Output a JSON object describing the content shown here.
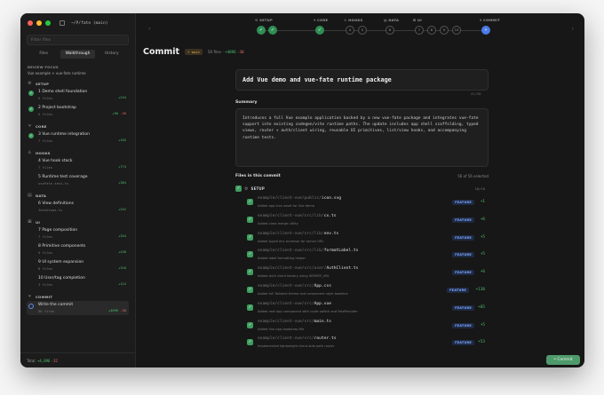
{
  "sidebar": {
    "repo": "~/P/fate (main)",
    "filter_placeholder": "Filter files",
    "tabs": [
      {
        "label": "Files",
        "active": false
      },
      {
        "label": "Walkthrough",
        "active": true
      },
      {
        "label": "History",
        "active": false
      }
    ],
    "review_focus": {
      "heading": "REVIEW FOCUS",
      "subtitle": "Vue example + vue-fate runtime"
    },
    "sections": [
      {
        "name": "SETUP",
        "items": [
          {
            "num": "1",
            "title": "Demo shell foundation",
            "sub": "5 files",
            "add": "+244",
            "del": "",
            "done": true
          },
          {
            "num": "2",
            "title": "Project bootstrap",
            "sub": "5 files",
            "add": "+90",
            "del": "-30",
            "done": true
          }
        ]
      },
      {
        "name": "CORE",
        "items": [
          {
            "num": "3",
            "title": "Vue runtime integration",
            "sub": "7 files",
            "add": "+183",
            "del": "",
            "done": true
          }
        ]
      },
      {
        "name": "HOOKS",
        "items": [
          {
            "num": "4",
            "title": "Vue hook stack",
            "sub": "7 files",
            "add": "+774",
            "del": "",
            "done": false
          },
          {
            "num": "5",
            "title": "Runtime test coverage",
            "sub": "useFate.test.ts",
            "add": "+384",
            "del": "",
            "done": false
          }
        ]
      },
      {
        "name": "DATA",
        "items": [
          {
            "num": "6",
            "title": "View definitions",
            "sub": "fateViews.ts",
            "add": "+242",
            "del": "",
            "done": false
          }
        ]
      },
      {
        "name": "UI",
        "items": [
          {
            "num": "7",
            "title": "Page composition",
            "sub": "7 files",
            "add": "+344",
            "del": "",
            "done": false
          },
          {
            "num": "8",
            "title": "Primitive components",
            "sub": "5 files",
            "add": "+430",
            "del": "",
            "done": false
          },
          {
            "num": "9",
            "title": "UI system expansion",
            "sub": "8 files",
            "add": "+310",
            "del": "",
            "done": false
          },
          {
            "num": "10",
            "title": "User/tag completion",
            "sub": "3 files",
            "add": "+124",
            "del": "",
            "done": false
          }
        ]
      },
      {
        "name": "COMMIT",
        "items": [
          {
            "num": "",
            "title": "Write the commit",
            "sub": "56 files",
            "add": "+4096",
            "del": "-30",
            "done": false,
            "selected": true
          }
        ]
      }
    ],
    "footer": {
      "label": "Total",
      "add": "+4,096",
      "del": "-32"
    }
  },
  "stepper": {
    "groups": [
      {
        "label": "SETUP",
        "icon": "⚙",
        "steps": [
          {
            "text": "✓",
            "state": "done"
          },
          {
            "text": "✓",
            "state": "done"
          }
        ]
      },
      {
        "label": "CORE",
        "icon": "⑂",
        "steps": [
          {
            "text": "✓",
            "state": "done"
          }
        ]
      },
      {
        "label": "HOOKS",
        "icon": "♙",
        "steps": [
          {
            "text": "4",
            "state": "todo"
          },
          {
            "text": "5",
            "state": "todo"
          }
        ]
      },
      {
        "label": "DATA",
        "icon": "▤",
        "steps": [
          {
            "text": "6",
            "state": "todo"
          }
        ]
      },
      {
        "label": "UI",
        "icon": "⊞",
        "steps": [
          {
            "text": "7",
            "state": "todo"
          },
          {
            "text": "8",
            "state": "todo"
          },
          {
            "text": "9",
            "state": "todo"
          },
          {
            "text": "10",
            "state": "todo"
          }
        ]
      },
      {
        "label": "COMMIT",
        "icon": "⑂",
        "steps": [
          {
            "text": "⑂",
            "state": "cur"
          }
        ]
      }
    ]
  },
  "page": {
    "title": "Commit",
    "branch": "main",
    "files_changed": "56 files",
    "add": "+4096",
    "del": "-30"
  },
  "commit": {
    "title": "Add Vue demo and vue-fate runtime package",
    "char_count": "41/50",
    "summary_label": "Summary",
    "summary": "Introduces a full Vue example application backed by a new vue-fate package and integrates vue-fate support into existing codegen/vite runtime paths. The update includes app shell scaffolding, typed views, router + auth/client wiring, reusable UI primitives, list/view hooks, and accompanying runtime tests.",
    "files_label": "Files in this commit",
    "files_selected": "56 of 56 selected",
    "group": {
      "name": "SETUP",
      "count": "10/10"
    },
    "files": [
      {
        "dir": "example/client-vue/public/",
        "name": "icon.svg",
        "desc": "Added app icon asset for Vue demo",
        "tag": "FEATURE",
        "add": "+1"
      },
      {
        "dir": "example/client-vue/src/lib/",
        "name": "cx.ts",
        "desc": "Added class merge utility",
        "tag": "FEATURE",
        "add": "+6"
      },
      {
        "dir": "example/client-vue/src/lib/",
        "name": "env.ts",
        "desc": "Added typed env accessor for server URL",
        "tag": "FEATURE",
        "add": "+5"
      },
      {
        "dir": "example/client-vue/src/lib/",
        "name": "formatLabel.ts",
        "desc": "Added label formatting helper",
        "tag": "FEATURE",
        "add": "+5"
      },
      {
        "dir": "example/client-vue/src/user/",
        "name": "AuthClient.ts",
        "desc": "Added Auth client factory using SERVER_URL",
        "tag": "FEATURE",
        "add": "+6"
      },
      {
        "dir": "example/client-vue/src/",
        "name": "App.css",
        "desc": "Added full Tailwind theme and component style baseline",
        "tag": "FEATURE",
        "add": "+130"
      },
      {
        "dir": "example/client-vue/src/",
        "name": "App.vue",
        "desc": "Added root app component with route switch and FateProvider",
        "tag": "FEATURE",
        "add": "+85"
      },
      {
        "dir": "example/client-vue/src/",
        "name": "main.ts",
        "desc": "Added Vue app bootstrap file",
        "tag": "FEATURE",
        "add": "+5"
      },
      {
        "dir": "example/client-vue/src/",
        "name": "router.ts",
        "desc": "Implemented lightweight client-side path router",
        "tag": "FEATURE",
        "add": "+53"
      }
    ]
  },
  "actions": {
    "commit_label": "Commit"
  },
  "colors": {
    "added": "#4cbf6e",
    "removed": "#e06a6a",
    "accent": "#4a7be8",
    "done": "#3f9e5f"
  }
}
